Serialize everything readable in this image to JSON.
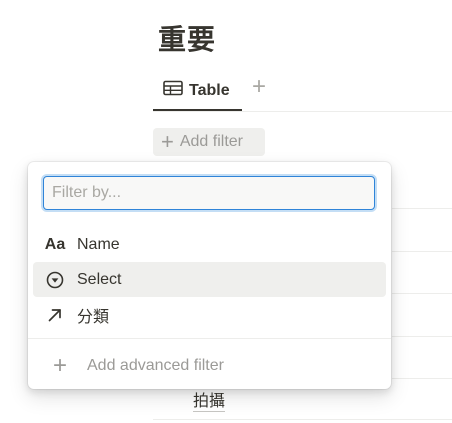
{
  "page": {
    "title": "重要"
  },
  "views": {
    "active_tab_label": "Table",
    "add_view_symbol": "+"
  },
  "toolbar": {
    "add_filter_label": "Add filter",
    "plus_symbol": "+"
  },
  "background": {
    "visible_cell_text": "拍攝"
  },
  "filter_menu": {
    "search_placeholder": "Filter by...",
    "search_value": "",
    "properties": [
      {
        "label": "Name",
        "icon": "text-type-icon",
        "icon_text": "Aa"
      },
      {
        "label": "Select",
        "icon": "select-chevron-circle-icon"
      },
      {
        "label": "分類",
        "icon": "relation-arrow-icon"
      }
    ],
    "advanced_label": "Add advanced filter",
    "plus_symbol": "+"
  },
  "colors": {
    "text": "#37352f",
    "muted": "#9b9a97",
    "focus_ring": "#2f84d8",
    "hover_bg": "#efefed"
  }
}
